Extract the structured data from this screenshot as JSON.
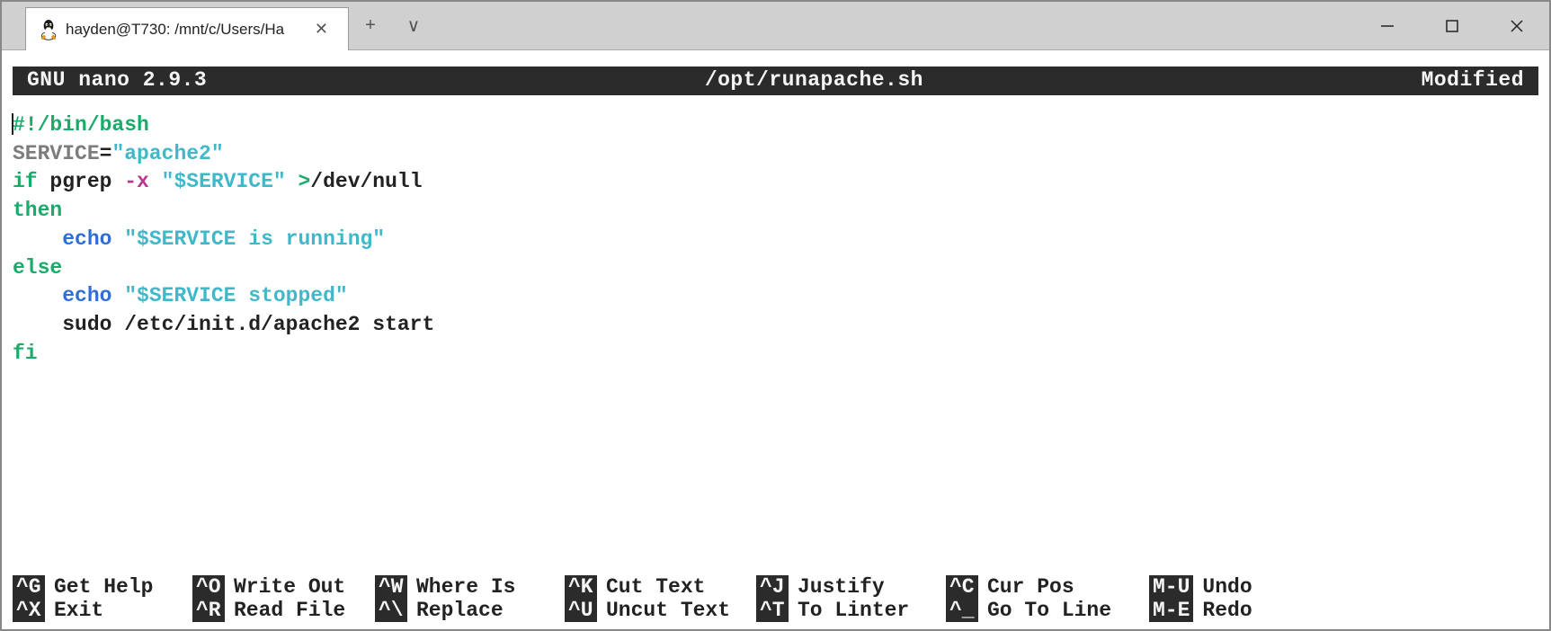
{
  "window": {
    "tab_title": "hayden@T730: /mnt/c/Users/Ha",
    "controls": {
      "minimize": "—",
      "maximize": "☐",
      "close": "✕"
    },
    "new_tab": "+",
    "chevron": "∨"
  },
  "nano": {
    "app": "GNU nano 2.9.3",
    "file": "/opt/runapache.sh",
    "status": "Modified"
  },
  "code": {
    "shebang": "#!/bin/bash",
    "l2_var": "SERVICE",
    "l2_eq": "=",
    "l2_str": "\"apache2\"",
    "l3_if": "if",
    "l3_cmd": " pgrep ",
    "l3_flag": "-x",
    "l3_sp": " ",
    "l3_str": "\"$SERVICE\"",
    "l3_op": " >",
    "l3_rest": "/dev/null",
    "l4_then": "then",
    "l5_pad": "    ",
    "l5_echo": "echo",
    "l5_sp": " ",
    "l5_str": "\"$SERVICE is running\"",
    "l6_else": "else",
    "l7_pad": "    ",
    "l7_echo": "echo",
    "l7_sp": " ",
    "l7_str": "\"$SERVICE stopped\"",
    "l8_pad": "    ",
    "l8_cmd": "sudo /etc/init.d/apache2 start",
    "l9_fi": "fi"
  },
  "footer": {
    "row1": [
      {
        "k": "^G",
        "l": "Get Help"
      },
      {
        "k": "^O",
        "l": "Write Out"
      },
      {
        "k": "^W",
        "l": "Where Is"
      },
      {
        "k": "^K",
        "l": "Cut Text"
      },
      {
        "k": "^J",
        "l": "Justify"
      },
      {
        "k": "^C",
        "l": "Cur Pos"
      },
      {
        "k": "M-U",
        "l": "Undo"
      }
    ],
    "row2": [
      {
        "k": "^X",
        "l": "Exit"
      },
      {
        "k": "^R",
        "l": "Read File"
      },
      {
        "k": "^\\",
        "l": "Replace"
      },
      {
        "k": "^U",
        "l": "Uncut Text"
      },
      {
        "k": "^T",
        "l": "To Linter"
      },
      {
        "k": "^_",
        "l": "Go To Line"
      },
      {
        "k": "M-E",
        "l": "Redo"
      }
    ]
  }
}
